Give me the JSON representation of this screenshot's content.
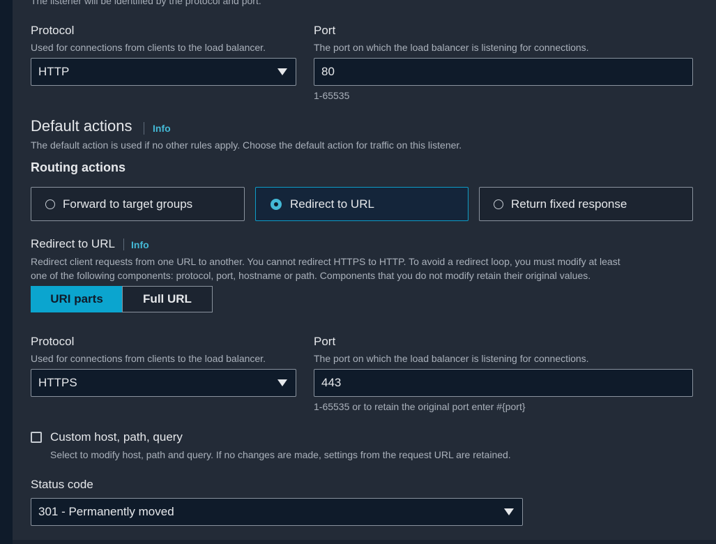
{
  "top_note": "The listener will be identified by the protocol and port.",
  "listener": {
    "protocol_label": "Protocol",
    "protocol_desc": "Used for connections from clients to the load balancer.",
    "protocol_value": "HTTP",
    "port_label": "Port",
    "port_desc": "The port on which the load balancer is listening for connections.",
    "port_value": "80",
    "port_hint": "1-65535"
  },
  "default_actions": {
    "title": "Default actions",
    "info": "Info",
    "desc": "The default action is used if no other rules apply. Choose the default action for traffic on this listener.",
    "routing_label": "Routing actions",
    "options": [
      {
        "label": "Forward to target groups",
        "selected": false
      },
      {
        "label": "Redirect to URL",
        "selected": true
      },
      {
        "label": "Return fixed response",
        "selected": false
      }
    ]
  },
  "redirect": {
    "title": "Redirect to URL",
    "info": "Info",
    "desc_line1": "Redirect client requests from one URL to another. You cannot redirect HTTPS to HTTP. To avoid a redirect loop, you must modify at least",
    "desc_line2": "one of the following components: protocol, port, hostname or path. Components that you do not modify retain their original values.",
    "segments": [
      {
        "label": "URI parts",
        "selected": true
      },
      {
        "label": "Full URL",
        "selected": false
      }
    ],
    "protocol_label": "Protocol",
    "protocol_desc": "Used for connections from clients to the load balancer.",
    "protocol_value": "HTTPS",
    "port_label": "Port",
    "port_desc": "The port on which the load balancer is listening for connections.",
    "port_value": "443",
    "port_hint": "1-65535 or to retain the original port enter #{port}",
    "custom_label": "Custom host, path, query",
    "custom_desc": "Select to modify host, path and query. If no changes are made, settings from the request URL are retained.",
    "custom_checked": false,
    "status_label": "Status code",
    "status_value": "301 - Permanently moved"
  },
  "colors": {
    "accent": "#0ba5cf",
    "link": "#44b9d6",
    "panel": "#232b37",
    "background": "#0f1b2a"
  }
}
